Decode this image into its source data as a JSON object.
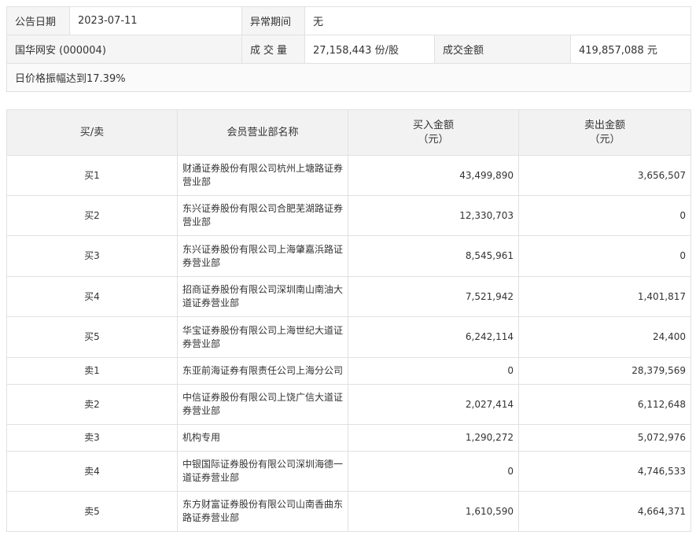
{
  "info": {
    "date_label": "公告日期",
    "date_value": "2023-07-11",
    "period_label": "异常期间",
    "period_value": "无",
    "stock_name": "国华网安 (000004)",
    "volume_label": "成交量",
    "volume_value": "27,158,443 份/股",
    "amount_label": "成交金额",
    "amount_value": "419,857,088 元",
    "reason": "日价格振幅达到17.39%"
  },
  "table": {
    "headers": {
      "side": "买/卖",
      "branch": "会员营业部名称",
      "buy_line1": "买入金额",
      "buy_line2": "（元）",
      "sell_line1": "卖出金额",
      "sell_line2": "（元）"
    },
    "rows": [
      {
        "side": "买1",
        "branch": "财通证券股份有限公司杭州上塘路证券营业部",
        "buy": "43,499,890",
        "sell": "3,656,507"
      },
      {
        "side": "买2",
        "branch": "东兴证券股份有限公司合肥芜湖路证券营业部",
        "buy": "12,330,703",
        "sell": "0"
      },
      {
        "side": "买3",
        "branch": "东兴证券股份有限公司上海肇嘉浜路证券营业部",
        "buy": "8,545,961",
        "sell": "0"
      },
      {
        "side": "买4",
        "branch": "招商证券股份有限公司深圳南山南油大道证券营业部",
        "buy": "7,521,942",
        "sell": "1,401,817"
      },
      {
        "side": "买5",
        "branch": "华宝证券股份有限公司上海世纪大道证券营业部",
        "buy": "6,242,114",
        "sell": "24,400"
      },
      {
        "side": "卖1",
        "branch": "东亚前海证券有限责任公司上海分公司",
        "buy": "0",
        "sell": "28,379,569"
      },
      {
        "side": "卖2",
        "branch": "中信证券股份有限公司上饶广信大道证券营业部",
        "buy": "2,027,414",
        "sell": "6,112,648"
      },
      {
        "side": "卖3",
        "branch": "机构专用",
        "buy": "1,290,272",
        "sell": "5,072,976"
      },
      {
        "side": "卖4",
        "branch": "中银国际证券股份有限公司深圳海德一道证券营业部",
        "buy": "0",
        "sell": "4,746,533"
      },
      {
        "side": "卖5",
        "branch": "东方财富证券股份有限公司山南香曲东路证券营业部",
        "buy": "1,610,590",
        "sell": "4,664,371"
      }
    ]
  }
}
